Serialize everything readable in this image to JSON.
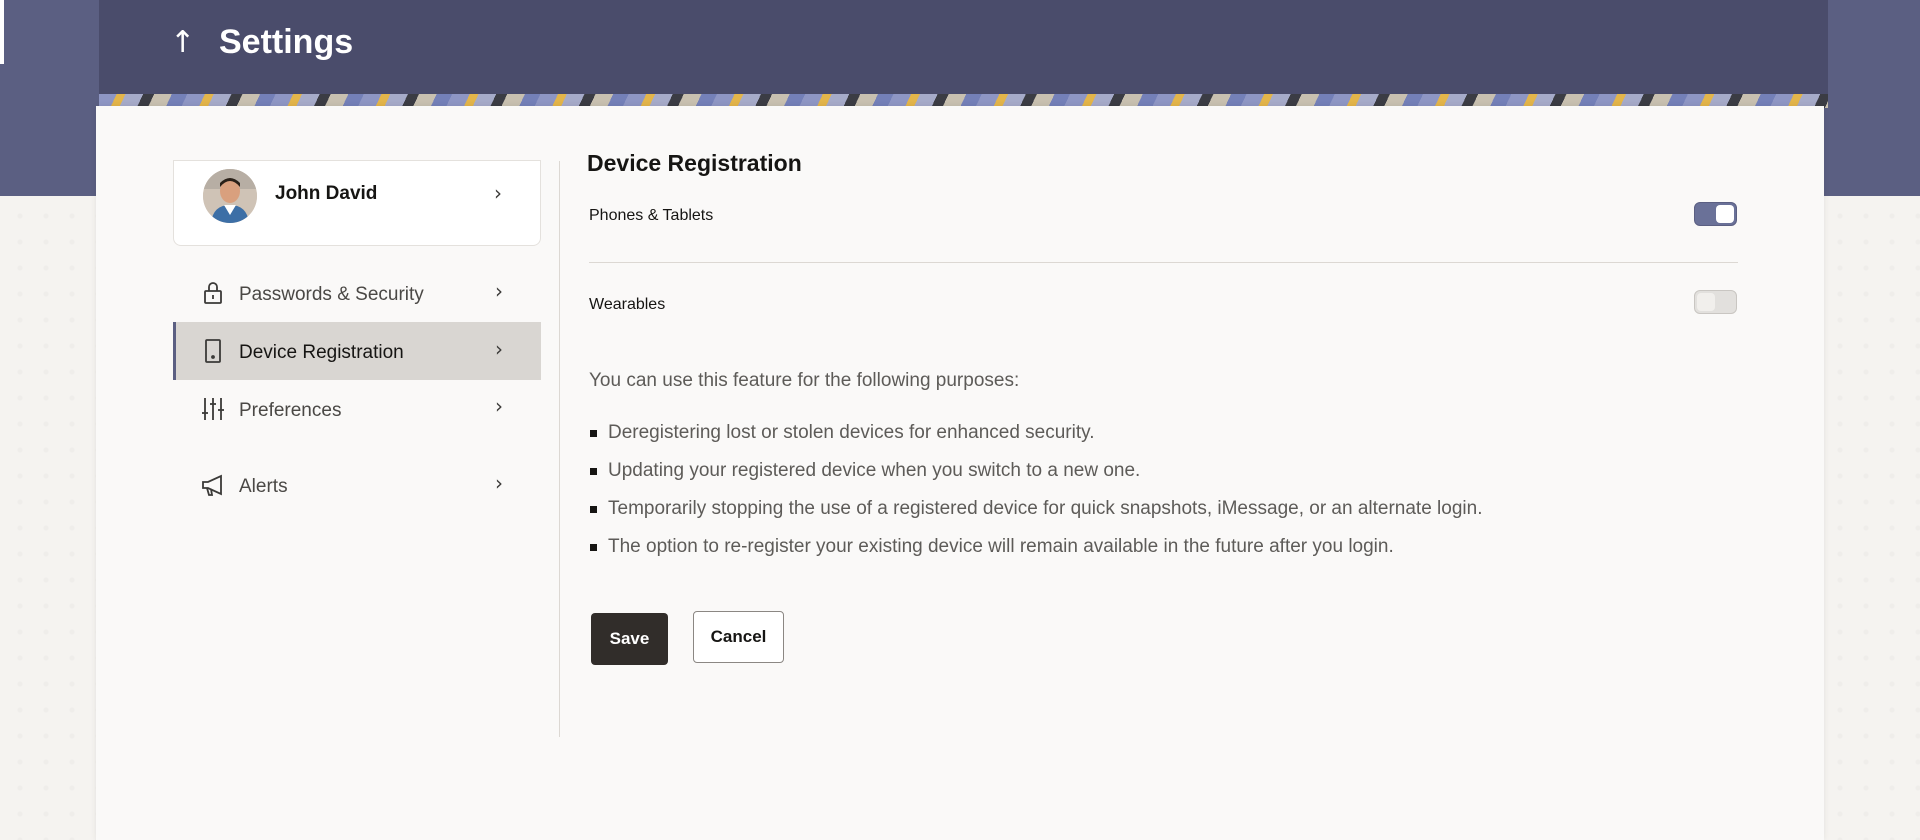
{
  "header": {
    "title": "Settings",
    "back_icon": "up-arrow-icon"
  },
  "profile": {
    "name": "John David",
    "avatar_icon": "user-avatar"
  },
  "sidebar": {
    "items": [
      {
        "label": "Passwords & Security",
        "icon": "lock-icon",
        "active": false
      },
      {
        "label": "Device Registration",
        "icon": "mobile-device-icon",
        "active": true
      },
      {
        "label": "Preferences",
        "icon": "sliders-icon",
        "active": false
      },
      {
        "label": "Alerts",
        "icon": "megaphone-icon",
        "active": false
      }
    ]
  },
  "main": {
    "title": "Device Registration",
    "toggles": [
      {
        "label": "Phones & Tablets",
        "on": true
      },
      {
        "label": "Wearables",
        "on": false
      }
    ],
    "intro": "You can use this feature for the following purposes:",
    "bullets": [
      "Deregistering lost or stolen devices for enhanced security.",
      "Updating your registered device when you switch to a new one.",
      "Temporarily stopping the use of a registered device for quick snapshots, iMessage, or an alternate login.",
      "The option to re-register your existing device will remain available in the future after you login."
    ],
    "save_label": "Save",
    "cancel_label": "Cancel"
  },
  "colors": {
    "header": "#4a4c6b",
    "accent": "#5b5f82",
    "toggle_on": "#6a7198",
    "save_button": "#312d2a"
  }
}
